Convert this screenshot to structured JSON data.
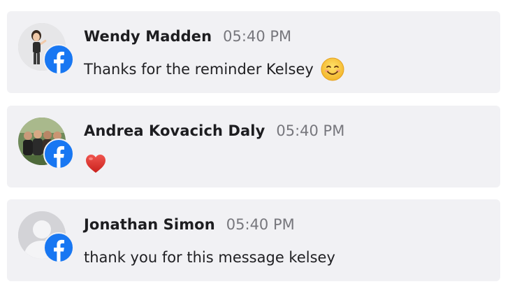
{
  "messages": [
    {
      "name": "Wendy Madden",
      "time": "05:40 PM",
      "text": "Thanks for the reminder Kelsey",
      "emoji": "smiling-face-emoji",
      "avatar": "bitmoji-avatar",
      "platform_icon": "facebook-icon"
    },
    {
      "name": "Andrea Kovacich Daly",
      "time": "05:40 PM",
      "text": "",
      "emoji": "red-heart-emoji",
      "avatar": "group-photo-avatar",
      "platform_icon": "facebook-icon"
    },
    {
      "name": "Jonathan Simon",
      "time": "05:40 PM",
      "text": "thank you for this message kelsey",
      "emoji": "",
      "avatar": "default-user-avatar",
      "platform_icon": "facebook-icon"
    }
  ],
  "colors": {
    "card_bg": "#f1f1f4",
    "facebook_blue": "#1877f2",
    "timestamp": "#77777d"
  }
}
